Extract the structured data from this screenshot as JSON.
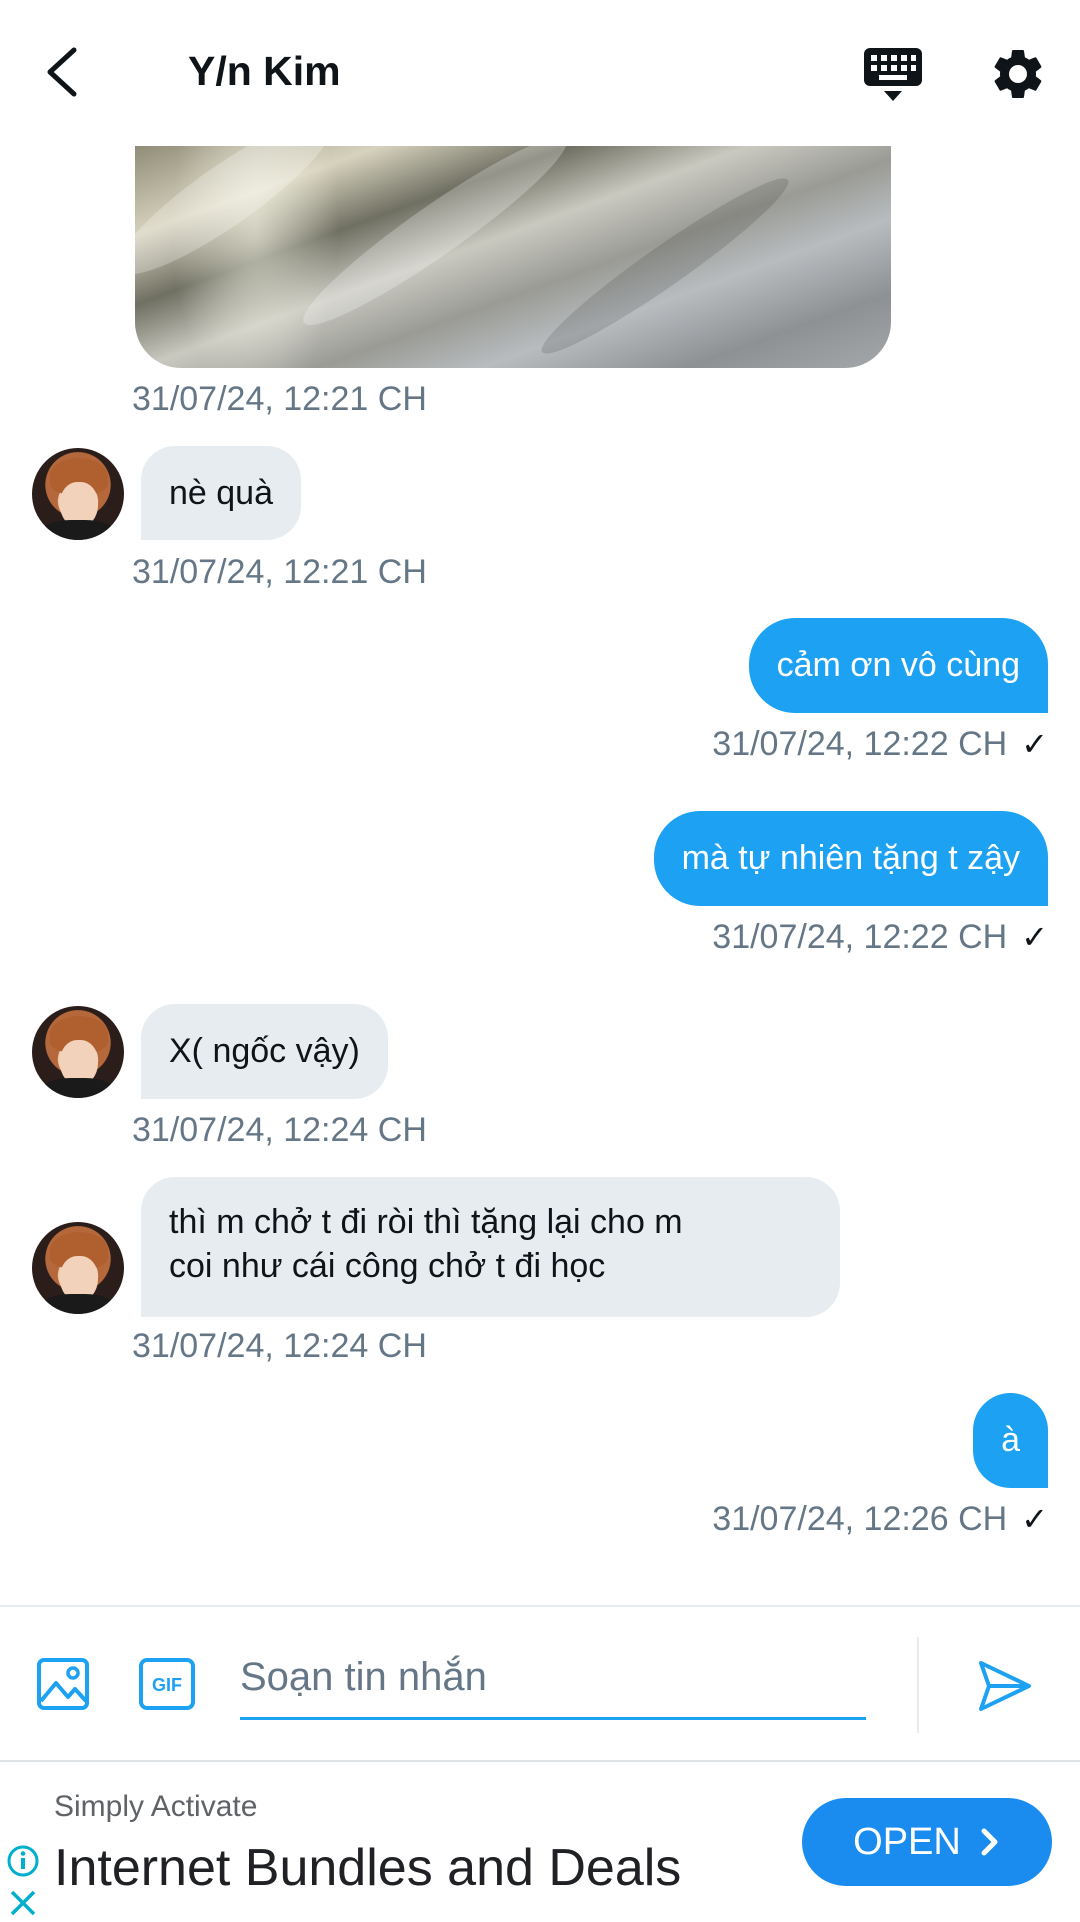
{
  "header": {
    "title": "Y/n Kim"
  },
  "messages": [
    {
      "type": "image",
      "sender": "other",
      "timestamp": "31/07/24, 12:21 CH"
    },
    {
      "type": "text",
      "sender": "other",
      "text": "nè quà",
      "timestamp": "31/07/24, 12:21 CH"
    },
    {
      "type": "text",
      "sender": "me",
      "text": "cảm ơn vô cùng",
      "timestamp": "31/07/24, 12:22 CH",
      "status": "✓"
    },
    {
      "type": "text",
      "sender": "me",
      "text": "mà tự nhiên tặng t zậy",
      "timestamp": "31/07/24, 12:22 CH",
      "status": "✓"
    },
    {
      "type": "text",
      "sender": "other",
      "text": "X( ngốc vậy)",
      "timestamp": "31/07/24, 12:24 CH"
    },
    {
      "type": "text",
      "sender": "other",
      "lines": [
        "thì m chở t đi ròi thì tặng lại cho m",
        "coi như cái công chở t đi học"
      ],
      "timestamp": "31/07/24, 12:24 CH"
    },
    {
      "type": "text",
      "sender": "me",
      "text": "à",
      "timestamp": "31/07/24, 12:26 CH",
      "status": "✓"
    }
  ],
  "composer": {
    "placeholder": "Soạn tin nhắn",
    "value": ""
  },
  "ad": {
    "advertiser": "Simply Activate",
    "headline": "Internet Bundles and Deals",
    "cta": "OPEN"
  },
  "colors": {
    "accent": "#1da1f2",
    "incoming_bubble": "#e6ecf0",
    "timestamp": "#657786",
    "ad_button": "#1a8cf0"
  },
  "icons": [
    "back-arrow-icon",
    "keyboard-icon",
    "gear-icon",
    "image-icon",
    "gif-icon",
    "send-icon",
    "ad-info-icon",
    "ad-close-icon",
    "chevron-right-icon"
  ]
}
